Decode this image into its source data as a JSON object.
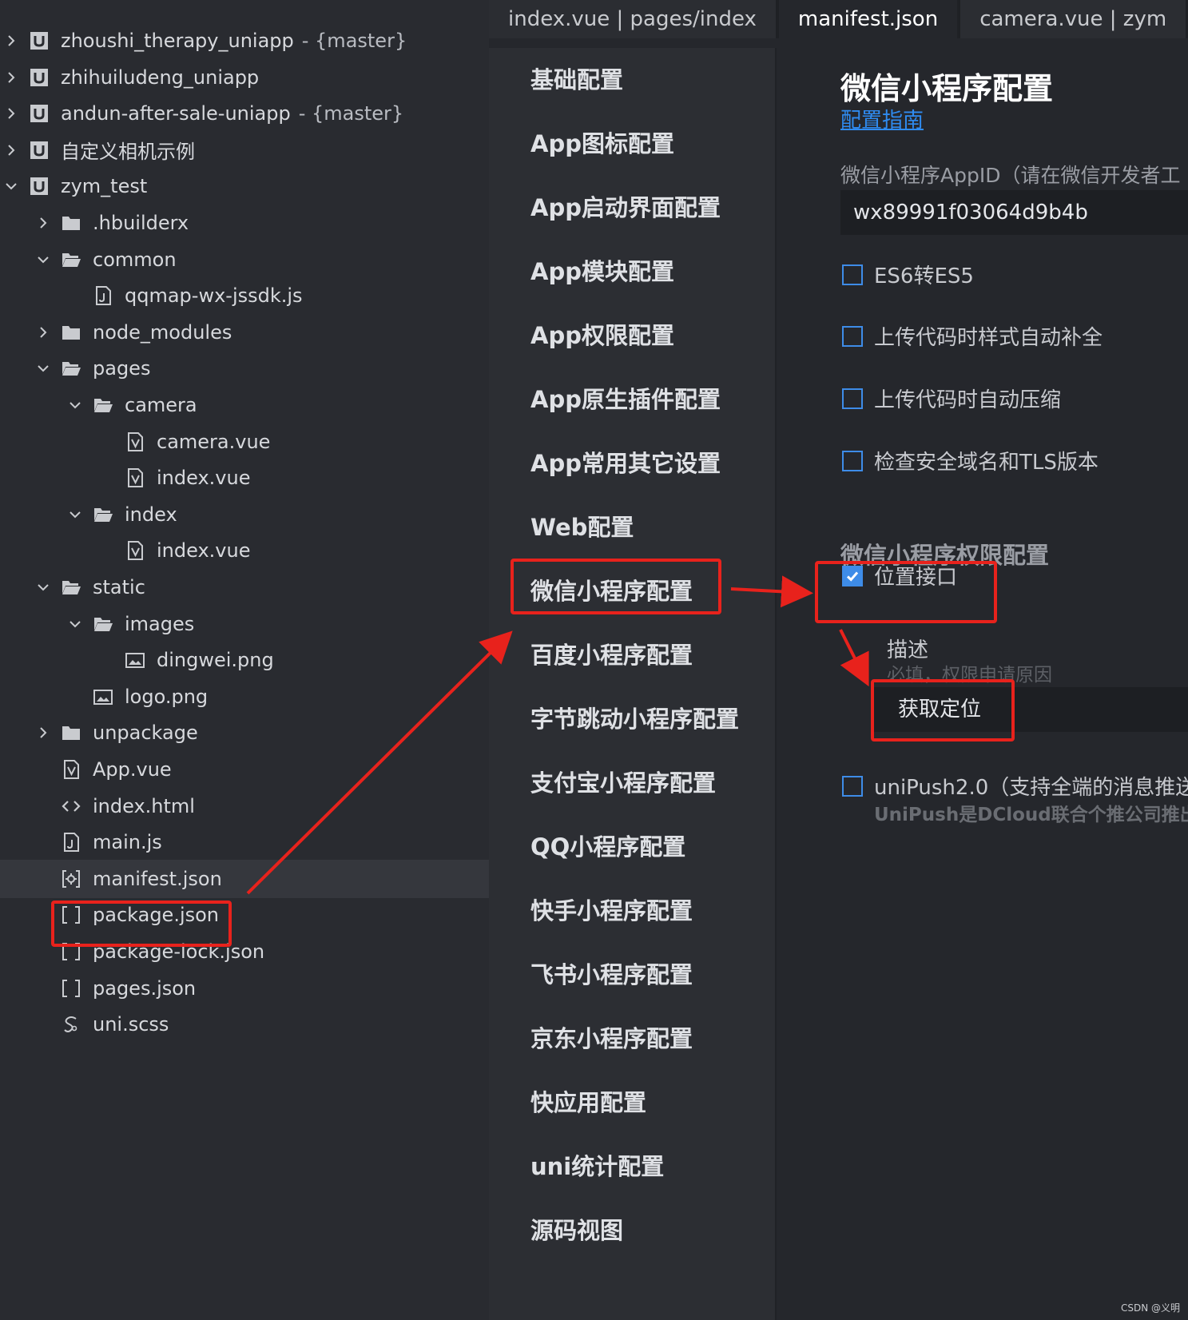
{
  "tree": {
    "items": [
      {
        "label": "zhoushi_therapy_uniapp",
        "branch": "- {master}",
        "icon": "uni-project-icon",
        "chev": "right"
      },
      {
        "label": "zhihuiludeng_uniapp",
        "branch": "",
        "icon": "uni-project-icon",
        "chev": "right"
      },
      {
        "label": "andun-after-sale-uniapp",
        "branch": "- {master}",
        "icon": "uni-project-icon",
        "chev": "right"
      },
      {
        "label": "自定义相机示例",
        "branch": "",
        "icon": "uni-project-icon",
        "chev": "right"
      },
      {
        "label": "zym_test",
        "branch": "",
        "icon": "uni-project-icon",
        "chev": "down"
      },
      {
        "label": ".hbuilderx",
        "branch": "",
        "icon": "folder-icon",
        "chev": "right"
      },
      {
        "label": "common",
        "branch": "",
        "icon": "folder-open-icon",
        "chev": "down"
      },
      {
        "label": "qqmap-wx-jssdk.js",
        "branch": "",
        "icon": "js-file-icon",
        "chev": ""
      },
      {
        "label": "node_modules",
        "branch": "",
        "icon": "folder-icon",
        "chev": "right"
      },
      {
        "label": "pages",
        "branch": "",
        "icon": "folder-open-icon",
        "chev": "down"
      },
      {
        "label": "camera",
        "branch": "",
        "icon": "folder-open-icon",
        "chev": "down"
      },
      {
        "label": "camera.vue",
        "branch": "",
        "icon": "vue-file-icon",
        "chev": ""
      },
      {
        "label": "index.vue",
        "branch": "",
        "icon": "vue-file-icon",
        "chev": ""
      },
      {
        "label": "index",
        "branch": "",
        "icon": "folder-open-icon",
        "chev": "down"
      },
      {
        "label": "index.vue",
        "branch": "",
        "icon": "vue-file-icon",
        "chev": ""
      },
      {
        "label": "static",
        "branch": "",
        "icon": "folder-open-icon",
        "chev": "down"
      },
      {
        "label": "images",
        "branch": "",
        "icon": "folder-open-icon",
        "chev": "down"
      },
      {
        "label": "dingwei.png",
        "branch": "",
        "icon": "image-file-icon",
        "chev": ""
      },
      {
        "label": "logo.png",
        "branch": "",
        "icon": "image-file-icon",
        "chev": ""
      },
      {
        "label": "unpackage",
        "branch": "",
        "icon": "folder-icon",
        "chev": "right"
      },
      {
        "label": "App.vue",
        "branch": "",
        "icon": "vue-file-icon",
        "chev": ""
      },
      {
        "label": "index.html",
        "branch": "",
        "icon": "html-file-icon",
        "chev": ""
      },
      {
        "label": "main.js",
        "branch": "",
        "icon": "js-file-icon",
        "chev": ""
      },
      {
        "label": "manifest.json",
        "branch": "",
        "icon": "manifest-file-icon",
        "chev": ""
      },
      {
        "label": "package.json",
        "branch": "",
        "icon": "json-file-icon",
        "chev": ""
      },
      {
        "label": "package-lock.json",
        "branch": "",
        "icon": "json-file-icon",
        "chev": ""
      },
      {
        "label": "pages.json",
        "branch": "",
        "icon": "json-file-icon",
        "chev": ""
      },
      {
        "label": "uni.scss",
        "branch": "",
        "icon": "scss-file-icon",
        "chev": ""
      }
    ]
  },
  "tabs": [
    {
      "label": "index.vue | pages/index",
      "active": false
    },
    {
      "label": "manifest.json",
      "active": true
    },
    {
      "label": "camera.vue | zym",
      "active": false
    }
  ],
  "nav": {
    "items": [
      "基础配置",
      "App图标配置",
      "App启动界面配置",
      "App模块配置",
      "App权限配置",
      "App原生插件配置",
      "App常用其它设置",
      "Web配置",
      "微信小程序配置",
      "百度小程序配置",
      "字节跳动小程序配置",
      "支付宝小程序配置",
      "QQ小程序配置",
      "快手小程序配置",
      "飞书小程序配置",
      "京东小程序配置",
      "快应用配置",
      "uni统计配置",
      "源码视图"
    ]
  },
  "settings": {
    "title": "微信小程序配置",
    "guide_link": "配置指南",
    "appid_label": "微信小程序AppID（请在微信开发者工",
    "appid_value": "wx89991f03064d9b4b",
    "options": [
      {
        "label": "ES6转ES5",
        "checked": false
      },
      {
        "label": "上传代码时样式自动补全",
        "checked": false
      },
      {
        "label": "上传代码时自动压缩",
        "checked": false
      },
      {
        "label": "检查安全域名和TLS版本",
        "checked": false
      }
    ],
    "permission_title": "微信小程序权限配置",
    "location_label": "位置接口",
    "location_checked": true,
    "desc_label": "描述",
    "desc_hint": "必填，权限申请原因",
    "desc_value": "获取定位",
    "unipush_label": "uniPush2.0（支持全端的消息推送",
    "unipush_sub": "UniPush是DCloud联合个推公司推出"
  },
  "colors": {
    "accent": "#3e8ce8",
    "annotation": "#e8221c",
    "link": "#2f8bf0"
  },
  "watermark": "CSDN @义明"
}
